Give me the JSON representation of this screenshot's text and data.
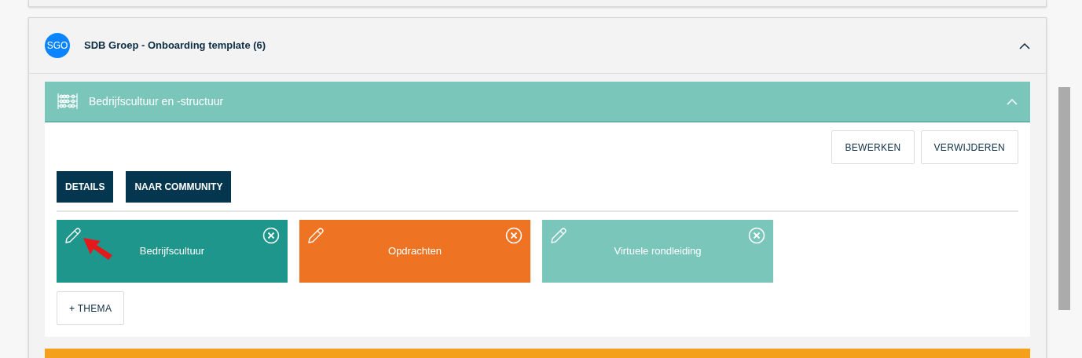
{
  "group": {
    "avatar": "SGO",
    "title": "SDB Groep - Onboarding template (6)",
    "expanded": true
  },
  "section": {
    "title": "Bedrijfscultuur en -structuur",
    "expanded": true,
    "actions": [
      "BEWERKEN",
      "VERWIJDEREN"
    ],
    "links": [
      "DETAILS",
      "NAAR COMMUNITY"
    ],
    "themes": [
      {
        "title": "Bedrijfscultuur",
        "color": "#1f968b"
      },
      {
        "title": "Opdrachten",
        "color": "#ee7423"
      },
      {
        "title": "Virtuele rondleiding",
        "color": "#7bc6bb"
      }
    ],
    "add_button": "+ THEMA"
  }
}
